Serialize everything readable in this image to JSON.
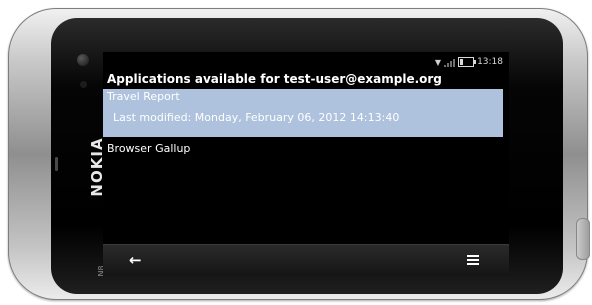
{
  "device": {
    "brand": "NOKIA",
    "model": "N8"
  },
  "status_bar": {
    "time": "13:18",
    "signal_icon": "antenna-icon",
    "battery_icon": "battery-icon"
  },
  "page": {
    "title": "Applications available for test-user@example.org"
  },
  "apps": [
    {
      "name": "Travel Report",
      "subtitle": "Last modified: Monday, February 06, 2012 14:13:40",
      "selected": true
    },
    {
      "name": "Browser Gallup",
      "selected": false
    }
  ],
  "toolbar": {
    "back_icon": "back-arrow-icon",
    "menu_icon": "menu-icon"
  },
  "colors": {
    "selection": "#aec2dd",
    "background": "#000000",
    "text": "#ffffff"
  }
}
